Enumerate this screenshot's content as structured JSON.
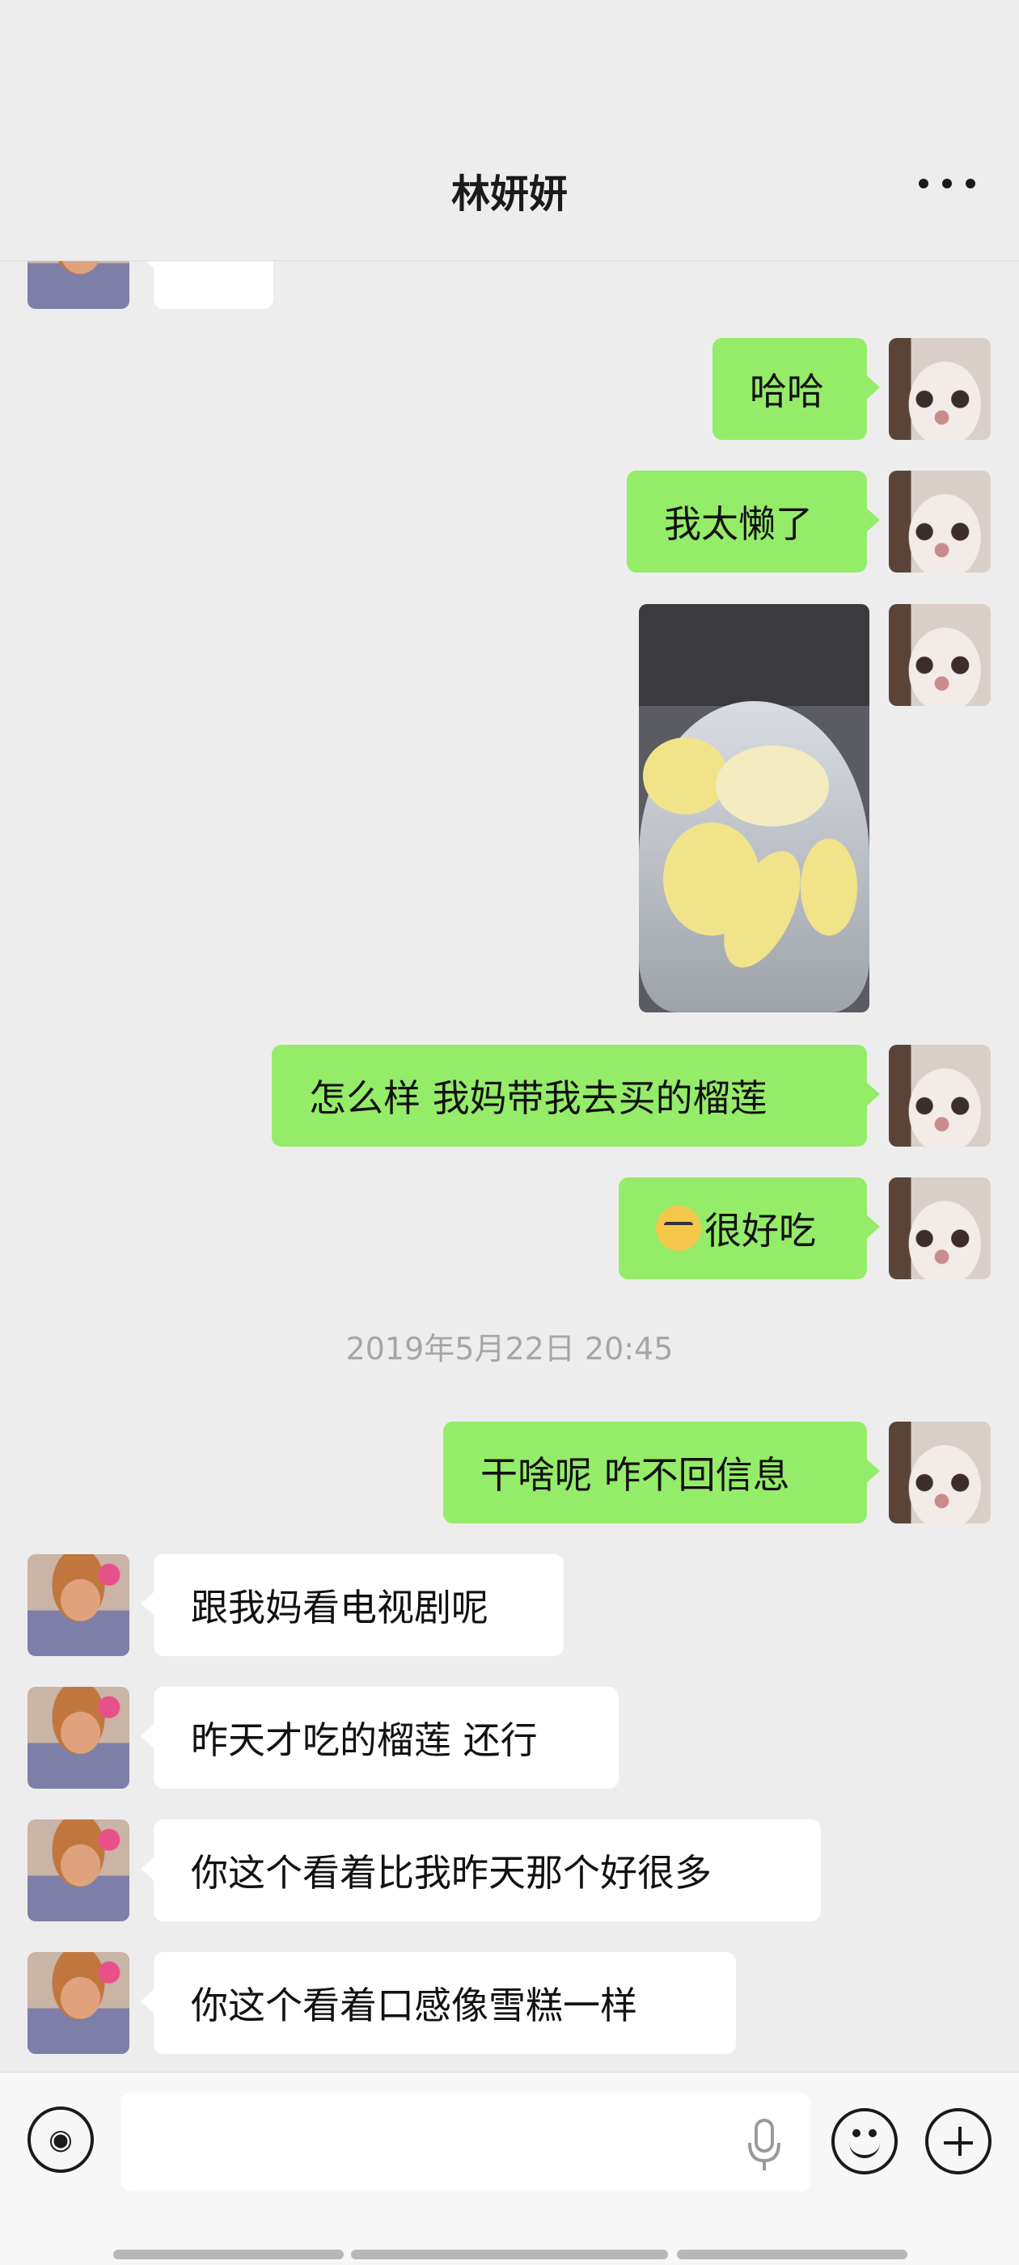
{
  "header": {
    "title": "林妍妍"
  },
  "messages": {
    "m1": "哈哈",
    "m2": "我太懒了",
    "m3": "怎么样 我妈带我去买的榴莲",
    "m4": "很好吃",
    "timestamp": "2019年5月22日 20:45",
    "m5": "干啥呢 咋不回信息",
    "r1": "跟我妈看电视剧呢",
    "r2": "昨天才吃的榴莲 还行",
    "r3": "你这个看着比我昨天那个好很多",
    "r4": "你这个看着口感像雪糕一样"
  },
  "colors": {
    "my_bubble": "#95ec69",
    "their_bubble": "#ffffff",
    "background": "#ededed"
  }
}
